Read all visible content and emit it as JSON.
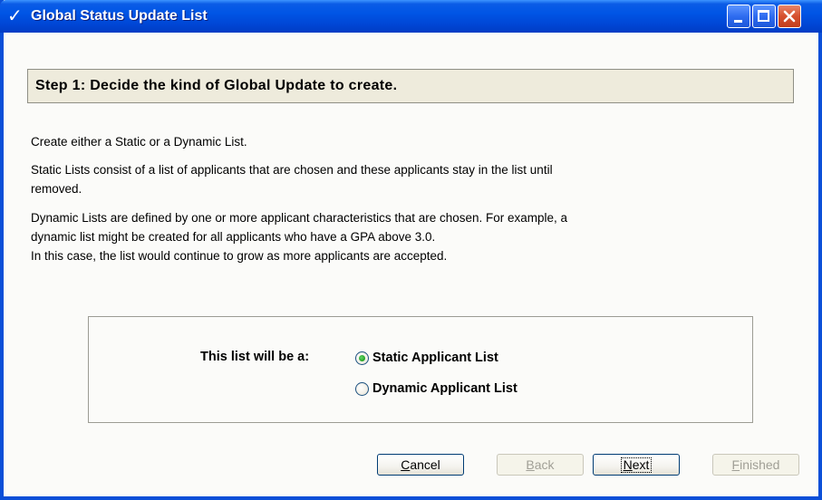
{
  "window": {
    "title": "Global Status Update List",
    "title_icon": "check-icon"
  },
  "step": {
    "header": "Step 1: Decide the kind of Global Update to create."
  },
  "description": {
    "line1": "Create either a Static or a Dynamic List.",
    "static_line1": "Static Lists consist of a list of applicants that are chosen and these applicants stay in the list until",
    "static_line2": "removed.",
    "dynamic_line1": "Dynamic Lists are defined by one or more applicant characteristics that are chosen. For example, a",
    "dynamic_line2": "dynamic list might be created for all applicants who have a GPA above 3.0.",
    "dynamic_line3": "In this case, the list would continue to grow as more applicants are accepted."
  },
  "list_type": {
    "prompt": "This list will be a:",
    "options": [
      {
        "label": "Static Applicant List",
        "checked": true
      },
      {
        "label": "Dynamic Applicant List",
        "checked": false
      }
    ]
  },
  "buttons": {
    "cancel": {
      "first": "C",
      "rest": "ancel",
      "enabled": true
    },
    "back": {
      "first": "B",
      "rest": "ack",
      "enabled": false
    },
    "next": {
      "first": "N",
      "rest": "ext",
      "enabled": true,
      "focused": true
    },
    "finished": {
      "first": "F",
      "rest": "inished",
      "enabled": false
    }
  },
  "colors": {
    "titlebar": "#0055e5",
    "panel": "#fbfbf9",
    "header_bg": "#eeebdc",
    "radio_checked": "#21a121"
  }
}
